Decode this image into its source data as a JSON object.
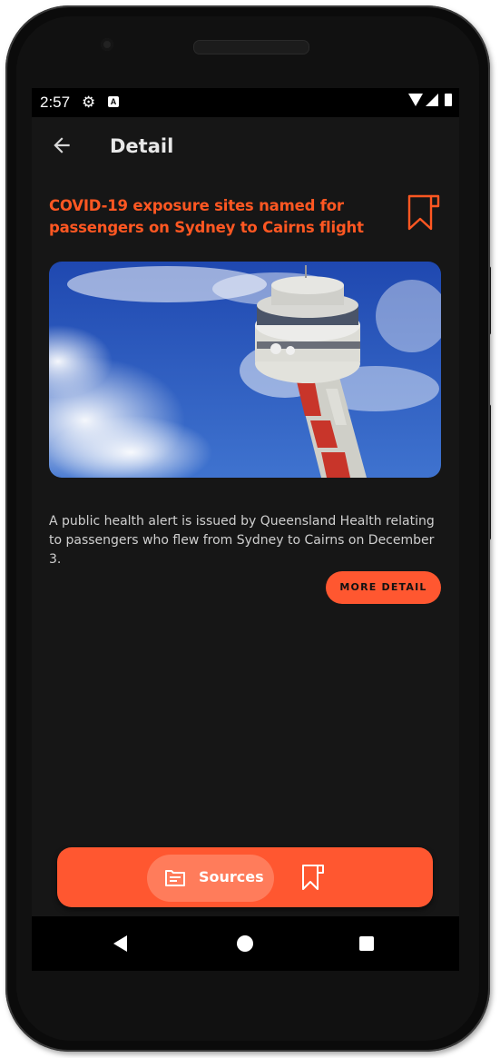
{
  "status_bar": {
    "time": "2:57",
    "settings_icon": "gear-icon",
    "notification_icon": "A"
  },
  "app_bar": {
    "title": "Detail",
    "back_icon": "arrow-back-icon"
  },
  "article": {
    "headline": "COVID-19 exposure sites named for passengers on Sydney to Cairns flight",
    "summary": "A public health alert is issued by Queensland Health relating to passengers who flew from Sydney to Cairns on December 3.",
    "more_label": "MORE DETAIL",
    "bookmark_icon": "bookmark-icon",
    "image_alt": "airport-control-tower"
  },
  "bottom_nav": {
    "sources_label": "Sources",
    "sources_icon": "newspaper-icon",
    "bookmarks_icon": "bookmark-icon"
  },
  "colors": {
    "accent": "#ff5722",
    "background": "#161616",
    "nav_active": "#ff7c5b"
  }
}
